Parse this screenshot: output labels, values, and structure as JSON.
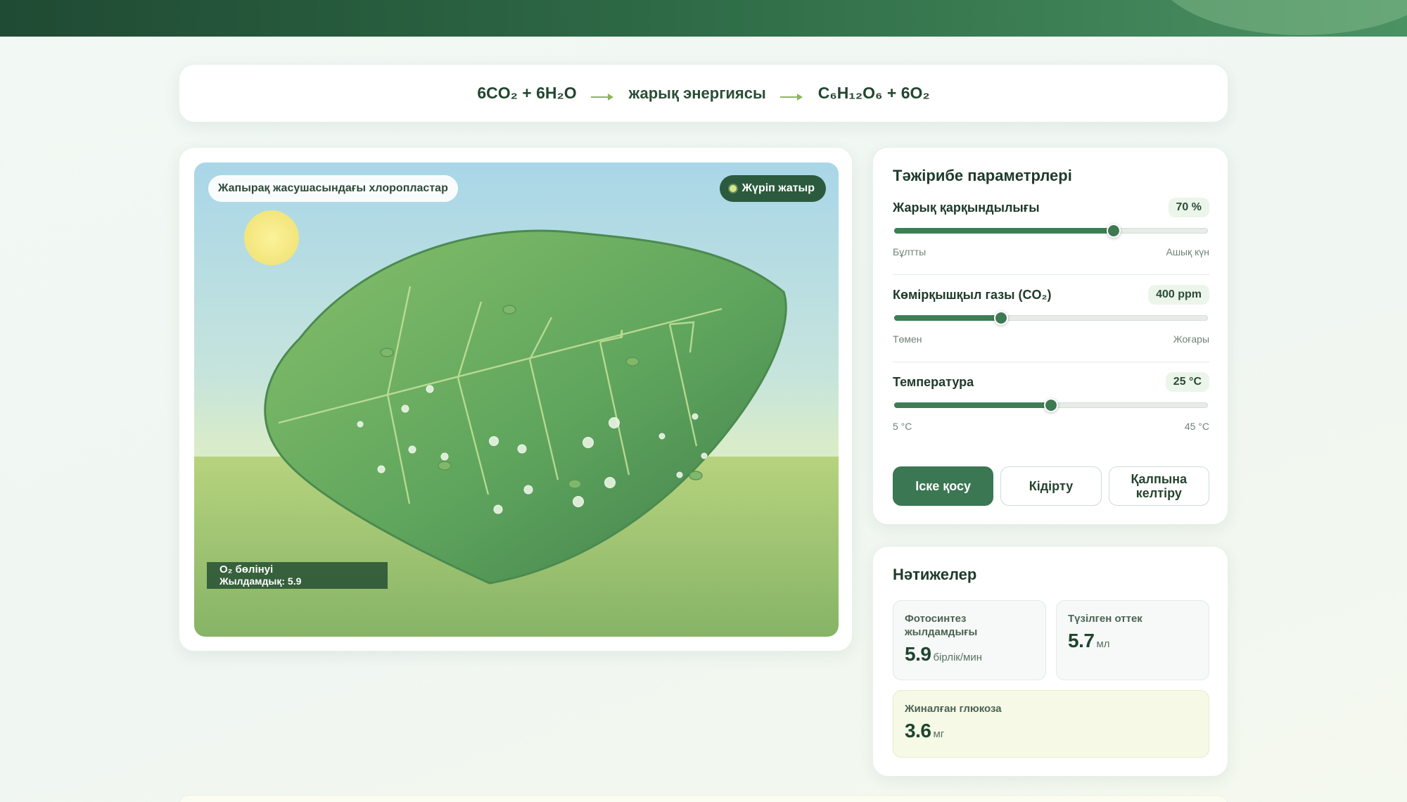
{
  "equation": {
    "reactants": "6CO₂ + 6H₂O",
    "condition": "жарық энергиясы",
    "products": "C₆H₁₂O₆ + 6O₂"
  },
  "simulation": {
    "scene_label": "Жапырақ жасушасындағы хлоропластар",
    "status": "Жүріп жатыр",
    "o2_title": "O₂ бөлінуі",
    "o2_rate": "Жылдамдық: 5.9",
    "o2_rate_value": 5.9
  },
  "parameters": {
    "title": "Тәжірибе параметрлері",
    "light": {
      "label": "Жарық қарқындылығы",
      "value": "70 %",
      "fraction": 0.7,
      "min_label": "Бұлтты",
      "max_label": "Ашық күн"
    },
    "co2": {
      "label": "Көмірқышқыл газы (CO₂)",
      "value": "400 ppm",
      "fraction": 0.34,
      "min_label": "Төмен",
      "max_label": "Жоғары"
    },
    "temperature": {
      "label": "Температура",
      "value": "25 °C",
      "fraction": 0.5,
      "min_label": "5 °C",
      "max_label": "45 °C"
    },
    "buttons": {
      "start": "Іске қосу",
      "pause": "Кідірту",
      "reset": "Қалпына келтіру"
    }
  },
  "results": {
    "title": "Нәтижелер",
    "rate": {
      "label": "Фотосинтез жылдамдығы",
      "value": "5.9",
      "unit": "бірлік/мин"
    },
    "oxygen": {
      "label": "Түзілген оттек",
      "value": "5.7",
      "unit": "мл"
    },
    "glucose": {
      "label": "Жиналған глюкоза",
      "value": "3.6",
      "unit": "мг"
    }
  },
  "colors": {
    "header": "#2f6c47",
    "accent": "#3a7752",
    "leaf": "#5ea85f",
    "sun": "#f6ec8d"
  }
}
